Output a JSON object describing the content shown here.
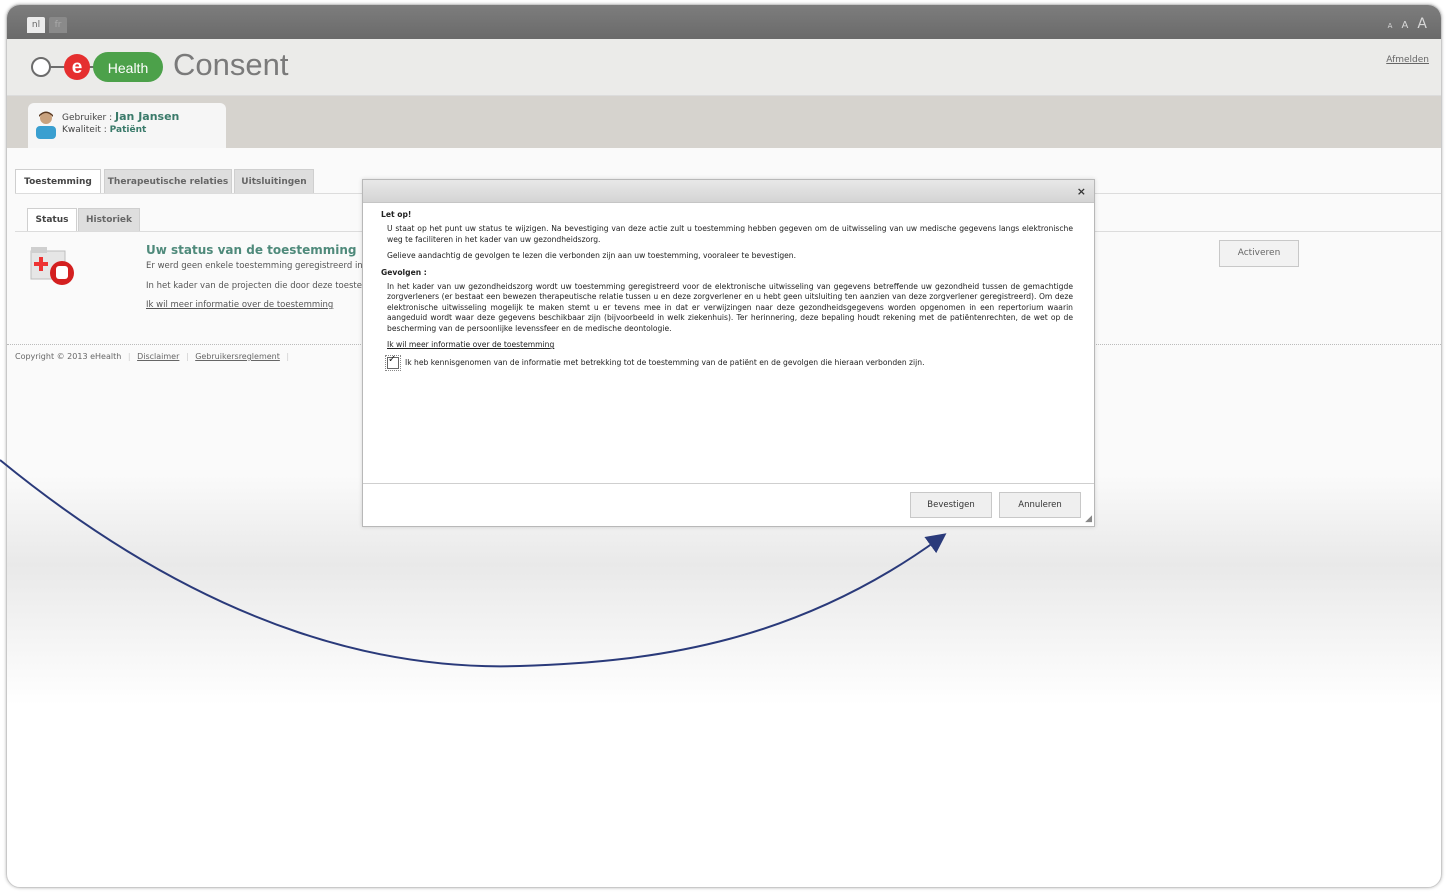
{
  "lang": {
    "nl": "nl",
    "fr": "fr"
  },
  "font_sizes": [
    "A",
    "A",
    "A"
  ],
  "header": {
    "logo_e": "e",
    "logo_health": "Health",
    "app_title": "Consent",
    "logout": "Afmelden"
  },
  "user": {
    "gebruiker_label": "Gebruiker :",
    "gebruiker_value": "Jan Jansen",
    "kwaliteit_label": "Kwaliteit :",
    "kwaliteit_value": "Patiënt"
  },
  "tabs": [
    {
      "label": "Toestemming"
    },
    {
      "label": "Therapeutische relaties"
    },
    {
      "label": "Uitsluitingen"
    }
  ],
  "subtabs": [
    {
      "label": "Status"
    },
    {
      "label": "Historiek"
    }
  ],
  "status": {
    "title": "Uw status van de toestemming",
    "line1": "Er werd geen enkele toestemming geregistreerd inz",
    "line2": "In het kader van de projecten die door deze toeste",
    "link": "Ik wil meer informatie over de toestemming",
    "activate_button": "Activeren"
  },
  "footer": {
    "copyright": "Copyright © 2013 eHealth",
    "disclaimer": "Disclaimer",
    "rules": "Gebruikersreglement"
  },
  "dialog": {
    "close": "×",
    "let_op": "Let op!",
    "p1": "U staat op het punt uw status te wijzigen. Na bevestiging van deze actie zult u toestemming hebben gegeven om de uitwisseling van uw medische gegevens langs elektronische weg te faciliteren in het kader van uw gezondheidszorg.",
    "p2": "Gelieve aandachtig de gevolgen te lezen die verbonden zijn aan uw toestemming, vooraleer te bevestigen.",
    "gevolgen": "Gevolgen :",
    "p3": "In het kader van uw gezondheidszorg wordt uw toestemming geregistreerd voor de elektronische uitwisseling van gegevens betreffende uw gezondheid tussen de gemachtigde zorgverleners (er bestaat een bewezen therapeutische relatie tussen u en deze zorgverlener en u hebt geen uitsluiting ten aanzien van deze zorgverlener geregistreerd). Om deze elektronische uitwisseling mogelijk te maken stemt u er tevens mee in dat er verwijzingen naar deze gezondheidsgegevens worden opgenomen in een repertorium waarin aangeduid wordt waar deze gegevens beschikbaar zijn (bijvoorbeeld in welk ziekenhuis). Ter herinnering, deze bepaling houdt rekening met de patiëntenrechten, de wet op de bescherming van de persoonlijke levenssfeer en de medische deontologie.",
    "link": "Ik wil meer informatie over de toestemming",
    "checkbox_label": "Ik heb kennisgenomen van de informatie met betrekking tot de toestemming van de patiënt en de gevolgen die hieraan verbonden zijn.",
    "checkbox_checked": true,
    "confirm": "Bevestigen",
    "cancel": "Annuleren"
  }
}
